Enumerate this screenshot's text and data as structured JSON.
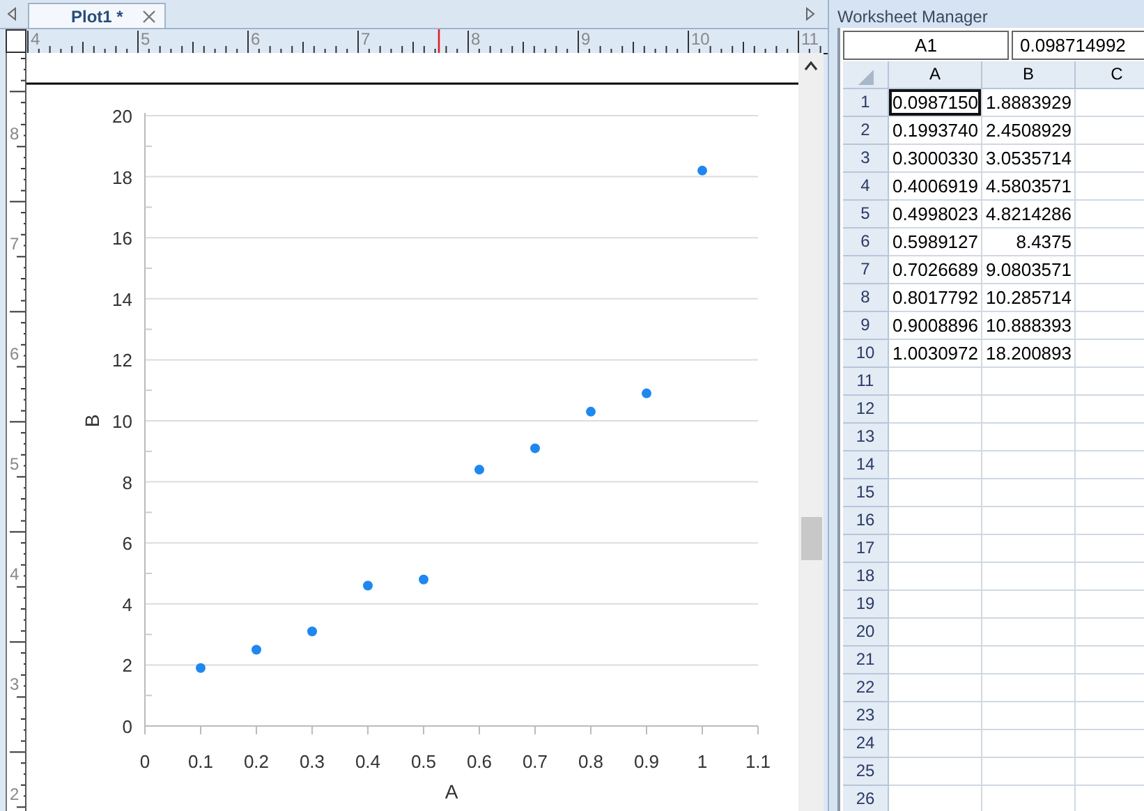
{
  "document_tabs": [
    {
      "label": "Plot1 *",
      "selected": true
    }
  ],
  "rulers": {
    "top_labels": [
      "4",
      "5",
      "6",
      "7",
      "8",
      "9",
      "10",
      "11"
    ],
    "left_labels": [
      "8",
      "7",
      "6",
      "5",
      "4",
      "3",
      "2"
    ]
  },
  "plot": {
    "chart_data": {
      "type": "scatter",
      "xlabel": "A",
      "ylabel": "B",
      "xlim": [
        0,
        1.1
      ],
      "ylim": [
        0,
        20
      ],
      "xticks": [
        0,
        0.1,
        0.2,
        0.3,
        0.4,
        0.5,
        0.6,
        0.7,
        0.8,
        0.9,
        1,
        1.1
      ],
      "yticks": [
        0,
        2,
        4,
        6,
        8,
        10,
        12,
        14,
        16,
        18,
        20
      ],
      "grid": true,
      "series": [
        {
          "color": "#1e88f0",
          "x": [
            0.1,
            0.2,
            0.3,
            0.4,
            0.5,
            0.6,
            0.7,
            0.8,
            0.9,
            1.0
          ],
          "values": [
            1.9,
            2.5,
            3.1,
            4.6,
            4.8,
            8.4,
            9.1,
            10.3,
            10.9,
            18.2
          ]
        }
      ]
    }
  },
  "worksheet_manager": {
    "title": "Worksheet Manager",
    "cell_name": "A1",
    "cell_value": "0.098714992",
    "columns": [
      "A",
      "B",
      "C"
    ],
    "rows": [
      {
        "label": "1",
        "cells": [
          {
            "text": "0.0987150",
            "selected": true
          },
          {
            "text": "1.8883929",
            "selected": false
          }
        ]
      },
      {
        "label": "2",
        "cells": [
          {
            "text": "0.1993740",
            "selected": false
          },
          {
            "text": "2.4508929",
            "selected": false
          }
        ]
      },
      {
        "label": "3",
        "cells": [
          {
            "text": "0.3000330",
            "selected": false
          },
          {
            "text": "3.0535714",
            "selected": false
          }
        ]
      },
      {
        "label": "4",
        "cells": [
          {
            "text": "0.4006919",
            "selected": false
          },
          {
            "text": "4.5803571",
            "selected": false
          }
        ]
      },
      {
        "label": "5",
        "cells": [
          {
            "text": "0.4998023",
            "selected": false
          },
          {
            "text": "4.8214286",
            "selected": false
          }
        ]
      },
      {
        "label": "6",
        "cells": [
          {
            "text": "0.5989127",
            "selected": false
          },
          {
            "text": "8.4375",
            "selected": false
          }
        ]
      },
      {
        "label": "7",
        "cells": [
          {
            "text": "0.7026689",
            "selected": false
          },
          {
            "text": "9.0803571",
            "selected": false
          }
        ]
      },
      {
        "label": "8",
        "cells": [
          {
            "text": "0.8017792",
            "selected": false
          },
          {
            "text": "10.285714",
            "selected": false
          }
        ]
      },
      {
        "label": "9",
        "cells": [
          {
            "text": "0.9008896",
            "selected": false
          },
          {
            "text": "10.888393",
            "selected": false
          }
        ]
      },
      {
        "label": "10",
        "cells": [
          {
            "text": "1.0030972",
            "selected": false
          },
          {
            "text": "18.200893",
            "selected": false
          }
        ]
      },
      {
        "label": "11"
      },
      {
        "label": "12"
      },
      {
        "label": "13"
      },
      {
        "label": "14"
      },
      {
        "label": "15"
      },
      {
        "label": "16"
      },
      {
        "label": "17"
      },
      {
        "label": "18"
      },
      {
        "label": "19"
      },
      {
        "label": "20"
      },
      {
        "label": "21"
      },
      {
        "label": "22"
      },
      {
        "label": "23"
      },
      {
        "label": "24"
      },
      {
        "label": "25"
      },
      {
        "label": "26"
      }
    ]
  }
}
